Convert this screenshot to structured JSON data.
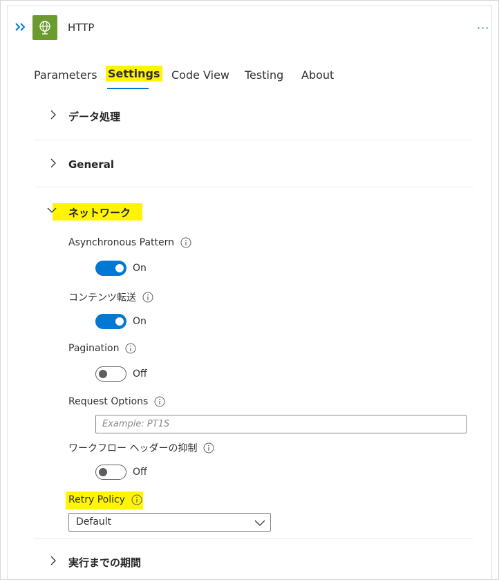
{
  "header": {
    "title": "HTTP"
  },
  "tabs": [
    {
      "label": "Parameters"
    },
    {
      "label": "Settings",
      "active": true
    },
    {
      "label": "Code View"
    },
    {
      "label": "Testing"
    },
    {
      "label": "About"
    }
  ],
  "sections": {
    "data_processing": {
      "title": "データ処理"
    },
    "general": {
      "title": "General"
    },
    "network": {
      "title": "ネットワーク"
    },
    "run_after": {
      "title": "実行までの期間"
    }
  },
  "settings": {
    "async_pattern": {
      "label": "Asynchronous Pattern",
      "state": "On"
    },
    "content_transfer": {
      "label": "コンテンツ転送",
      "state": "On"
    },
    "pagination": {
      "label": "Pagination",
      "state": "Off"
    },
    "request_options": {
      "label": "Request Options",
      "placeholder": "Example: PT1S"
    },
    "suppress_headers": {
      "label": "ワークフロー ヘッダーの抑制",
      "state": "Off"
    },
    "retry_policy": {
      "label": "Retry Policy",
      "value": "Default"
    }
  },
  "colors": {
    "accent": "#0078d4",
    "highlight": "#fff500",
    "app_icon_bg": "#6b9a2e"
  },
  "icons": {
    "expand": "double-chevron-right-icon",
    "app": "globe-icon",
    "more": "ellipsis-icon",
    "info": "info-icon",
    "chevron_right": "chevron-right-icon",
    "chevron_down": "chevron-down-icon"
  }
}
